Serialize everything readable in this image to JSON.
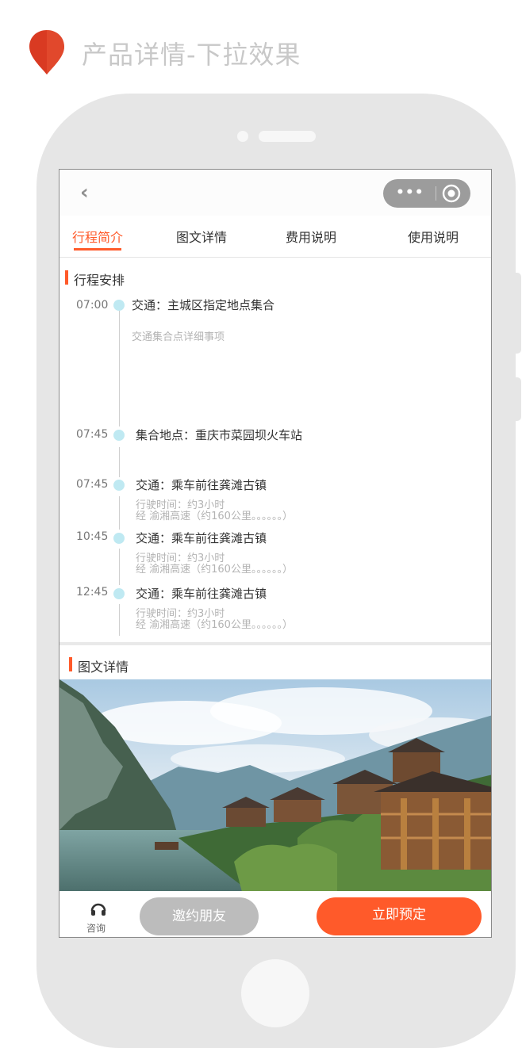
{
  "page": {
    "heading": "产品详情-下拉效果"
  },
  "icons": {
    "pin": "map-pin-icon",
    "back": "chevron-left-icon",
    "more": "more-dots-icon",
    "close": "target-circle-icon",
    "consult": "headset-icon"
  },
  "colors": {
    "accent": "#ff5a2a",
    "pin": "#d93a22",
    "timeline_dot": "#bfe9f2",
    "invite_button": "#bcbcbc",
    "capsule": "#9c9c9c"
  },
  "nav": {
    "back_glyph": "‹",
    "capsule_dots": "•••"
  },
  "tabs": [
    {
      "label": "行程简介",
      "active": true
    },
    {
      "label": "图文详情",
      "active": false
    },
    {
      "label": "费用说明",
      "active": false
    },
    {
      "label": "使用说明",
      "active": false
    }
  ],
  "itinerary": {
    "title": "行程安排",
    "items": [
      {
        "time": "07:00",
        "title": "交通：主城区指定地点集合",
        "details": [
          "交通集合点详细事项"
        ]
      },
      {
        "time": "07:45",
        "title": "集合地点：重庆市菜园坝火车站",
        "details": []
      },
      {
        "time": "07:45",
        "title": "交通：乘车前往龚滩古镇",
        "details": [
          "行驶时间：约3小时",
          "经 渝湘高速（约160公里。。。。。。）"
        ]
      },
      {
        "time": "10:45",
        "title": "交通：乘车前往龚滩古镇",
        "details": [
          "行驶时间：约3小时",
          "经 渝湘高速（约160公里。。。。。。）"
        ]
      },
      {
        "time": "12:45",
        "title": "交通：乘车前往龚滩古镇",
        "details": [
          "行驶时间：约3小时",
          "经 渝湘高速（约160公里。。。。。。）"
        ]
      }
    ]
  },
  "gallery": {
    "title": "图文详情"
  },
  "bottom": {
    "consult_label": "咨询",
    "invite_label": "邀约朋友",
    "book_label": "立即预定"
  }
}
